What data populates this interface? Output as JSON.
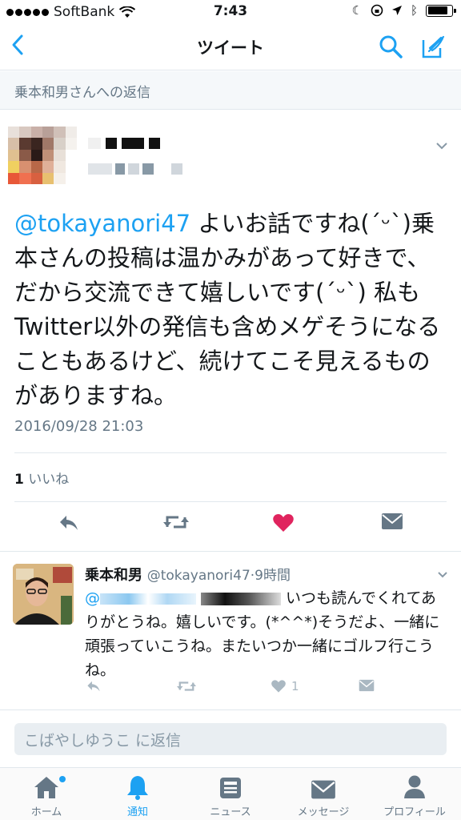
{
  "status_bar": {
    "carrier": "SoftBank",
    "time": "7:43",
    "battery_level": 0.85
  },
  "nav": {
    "title": "ツイート",
    "back_icon": "chevron-left-icon",
    "search_icon": "search-icon",
    "compose_icon": "compose-icon"
  },
  "reply_context": "乗本和男さんへの返信",
  "tweet": {
    "mention": "@tokayanori47",
    "text": " よいお話ですね(´ᵕ`)乗本さんの投稿は温かみがあって好きで、だから交流できて嬉しいです(´ᵕ`) 私もTwitter以外の発信も含めメゲそうになることもあるけど、続けてこそ見えるものがありますね。",
    "timestamp": "2016/09/28 21:03",
    "like_count": "1",
    "like_label": "いいね"
  },
  "reply": {
    "name": "乗本和男",
    "handle": "@tokayanori47",
    "time": "9時間",
    "mention_prefix": "@",
    "body": "いつも読んでくれてありがとうね。嬉しいです。(*^^*)そうだよ、一緒に頑張っていこうね。またいつか一緒にゴルフ行こうね。",
    "like_count": "1"
  },
  "reply_box": {
    "placeholder": "こばやしゆうこ に返信"
  },
  "tabs": [
    {
      "label": "ホーム",
      "icon": "home-icon"
    },
    {
      "label": "通知",
      "icon": "bell-icon"
    },
    {
      "label": "ニュース",
      "icon": "news-icon"
    },
    {
      "label": "メッセージ",
      "icon": "envelope-icon"
    },
    {
      "label": "プロフィール",
      "icon": "person-icon"
    }
  ],
  "colors": {
    "accent": "#1da1f2",
    "like": "#e0245e",
    "muted": "#657786"
  }
}
